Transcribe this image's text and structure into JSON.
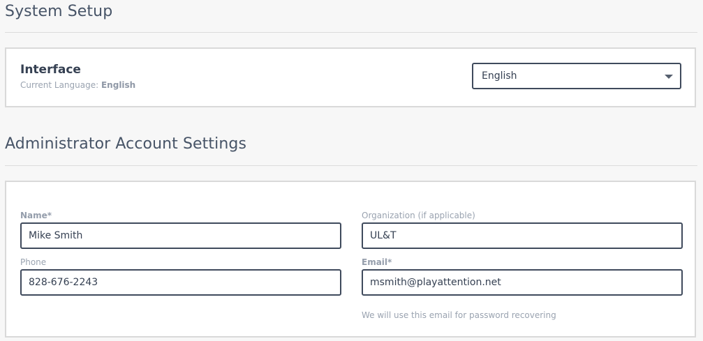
{
  "system_setup": {
    "title": "System Setup"
  },
  "interface": {
    "title": "Interface",
    "current_language_label": "Current Language:",
    "current_language_value": "English",
    "language_select_value": "English"
  },
  "admin": {
    "title": "Administrator Account Settings",
    "name_label": "Name*",
    "name_value": "Mike Smith",
    "organization_label": "Organization (if applicable)",
    "organization_value": "UL&T",
    "phone_label": "Phone",
    "phone_value": "828-676-2243",
    "email_label": "Email*",
    "email_value": "msmith@playattention.net",
    "email_hint": "We will use this email for password recovering"
  }
}
